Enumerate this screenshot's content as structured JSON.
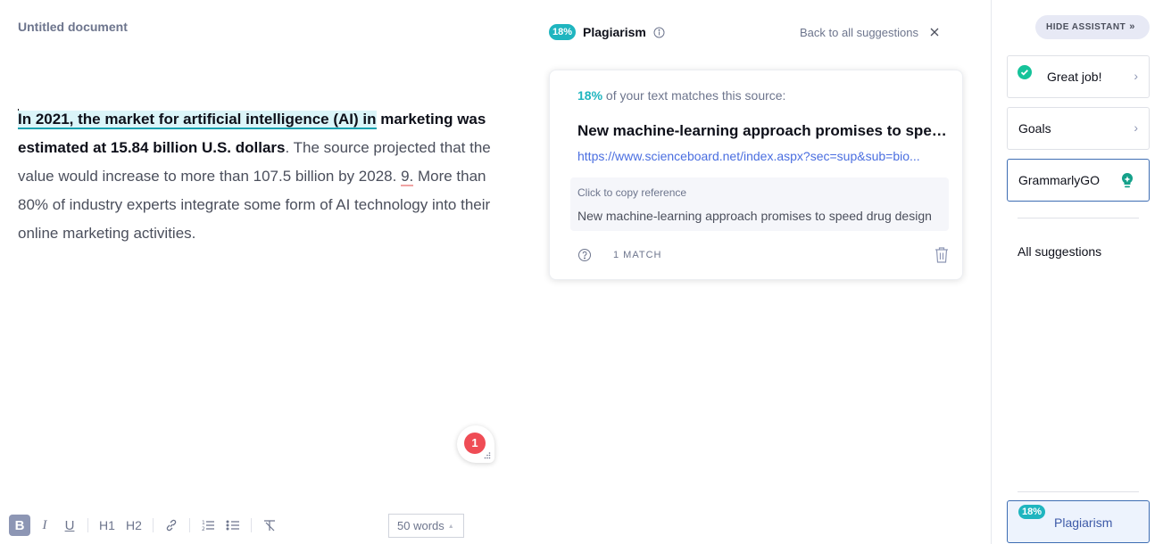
{
  "document": {
    "title": "Untitled document",
    "paragraph": {
      "highlighted_bold": "In 2021, the market for artificial intelligence (AI) in",
      "bold_rest": " marketing was estimated at 15.84 billion U.S. dollars",
      "plain_1": ". The source projected that the value would increase to more than 107.5 billion by 2028. ",
      "error_token": "9.",
      "plain_2": " More than 80% of industry experts integrate some form of AI technology into their online marketing activities."
    }
  },
  "floating_badge": {
    "count": "1"
  },
  "toolbar": {
    "bold": "B",
    "italic": "I",
    "underline": "U",
    "h1": "H1",
    "h2": "H2",
    "word_count": "50 words"
  },
  "plagiarism": {
    "percent": "18%",
    "title": "Plagiarism",
    "back_link": "Back to all suggestions",
    "card": {
      "match_percent": "18%",
      "match_text": " of your text matches this source:",
      "source_title": "New machine-learning approach promises to speed drug design",
      "source_url": "https://www.scienceboard.net/index.aspx?sec=sup&sub=bio...",
      "copy_label": "Click to copy reference",
      "reference_text": "New machine-learning approach promises to speed drug design",
      "match_count": "1 MATCH"
    }
  },
  "assistant": {
    "hide_button": "HIDE ASSISTANT",
    "items": [
      {
        "label": "Great job!"
      },
      {
        "label": "Goals"
      },
      {
        "label": "GrammarlyGO"
      }
    ],
    "all_suggestions": "All suggestions",
    "plagiarism_tab": {
      "percent": "18%",
      "label": "Plagiarism"
    }
  },
  "colors": {
    "accent_teal": "#1fb5bf",
    "success_green": "#15c39a",
    "error_red": "#ef4c55",
    "link_blue": "#4a6ee0",
    "active_blue": "#3d6db3"
  }
}
